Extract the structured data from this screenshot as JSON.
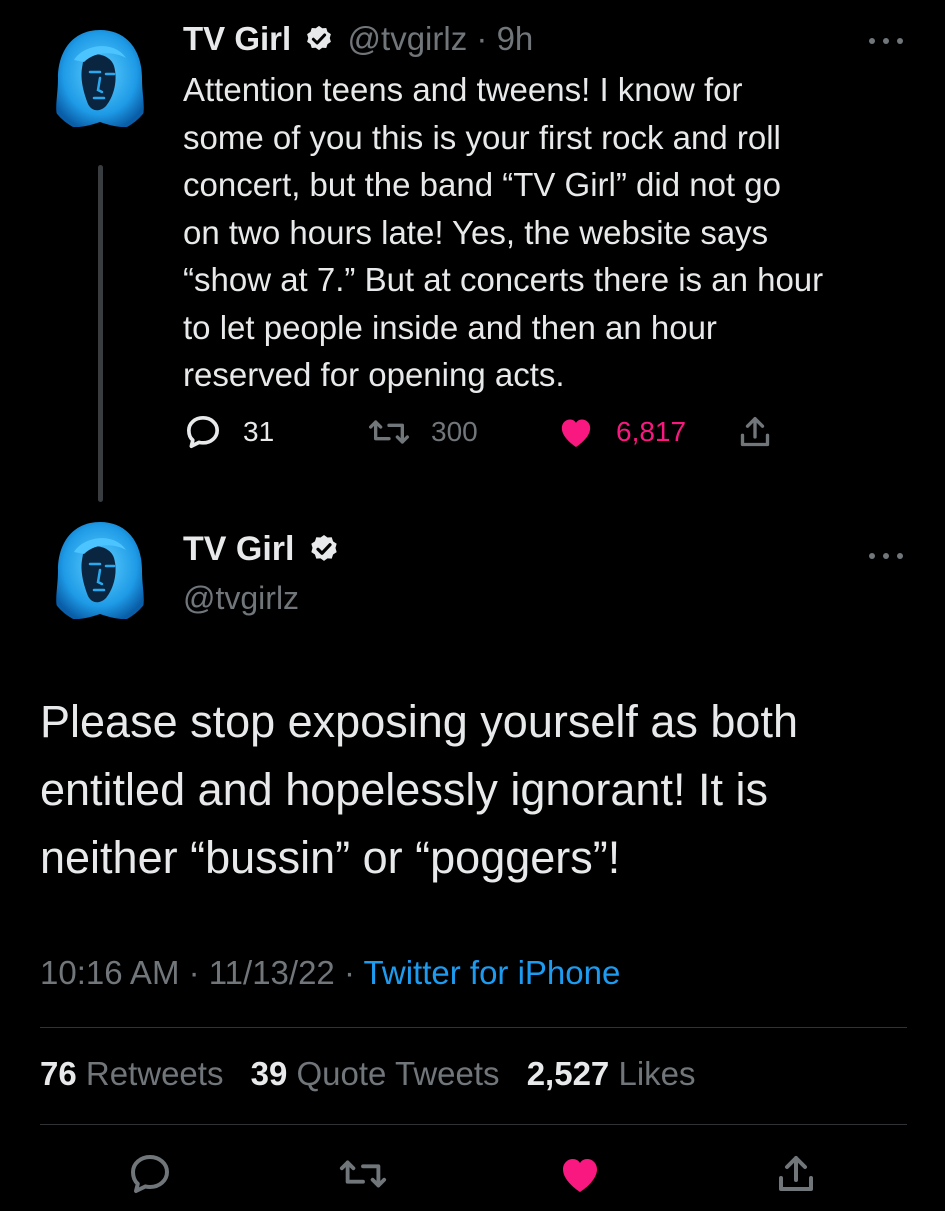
{
  "tweet1": {
    "name": "TV Girl",
    "handle": "@tvgirlz",
    "separator": "·",
    "time": "9h",
    "text": "Attention teens and tweens! I know for\nsome of you this is your first rock and roll\nconcert, but the band “TV Girl” did not go\non two hours late! Yes, the website says\n“show at 7.” But at concerts there is an hour\nto let people inside and then an hour\nreserved for opening acts.",
    "replies": "31",
    "retweets": "300",
    "likes": "6,817"
  },
  "tweet2": {
    "name": "TV Girl",
    "handle": "@tvgirlz",
    "text": "Please stop exposing yourself as both\nentitled and hopelessly ignorant! It is\nneither “bussin” or “poggers”!",
    "time": "10:16 AM",
    "date": "11/13/22",
    "separator": "·",
    "source": "Twitter for iPhone",
    "retweets_count": "76",
    "retweets_label": "Retweets",
    "quotes_count": "39",
    "quotes_label": "Quote Tweets",
    "likes_count": "2,527",
    "likes_label": "Likes"
  },
  "colors": {
    "background": "#000000",
    "text": "#e7e9ea",
    "muted": "#71767b",
    "link": "#1d9bf0",
    "like": "#f91880",
    "avatar": "#2aa8ee"
  },
  "icons": [
    "verified-icon",
    "more-icon",
    "reply-icon",
    "retweet-icon",
    "heart-icon",
    "share-icon"
  ]
}
